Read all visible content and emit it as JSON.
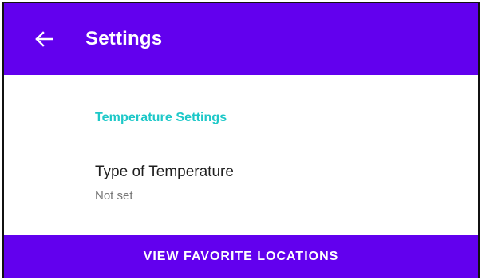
{
  "app_bar": {
    "title": "Settings",
    "back_icon": "arrow-back-icon",
    "background": "#6200ee"
  },
  "section": {
    "header": "Temperature Settings",
    "header_color": "#1ec8c8"
  },
  "preference": {
    "title": "Type of Temperature",
    "summary": "Not set"
  },
  "footer_button": {
    "label": "VIEW FAVORITE LOCATIONS",
    "background": "#6200ee"
  }
}
